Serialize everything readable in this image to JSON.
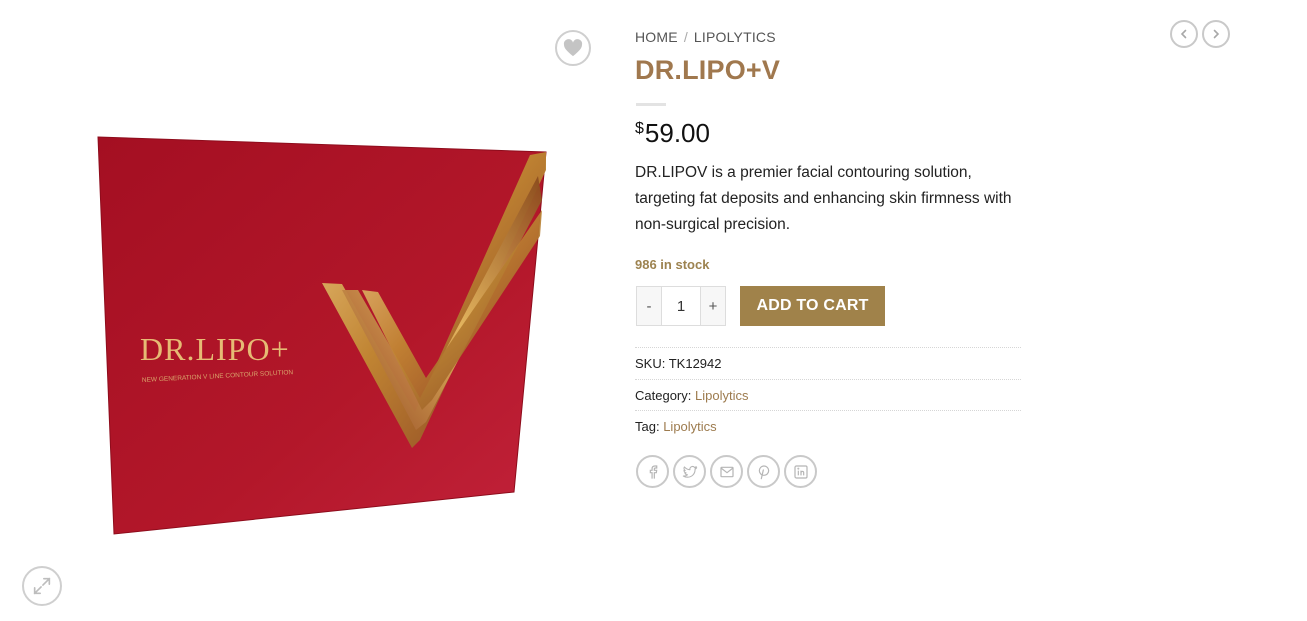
{
  "breadcrumb": {
    "home": "HOME",
    "separator": "/",
    "category": "LIPOLYTICS"
  },
  "product": {
    "title": "DR.LIPO+V",
    "currency": "$",
    "price": "59.00",
    "description": "DR.LIPOV is a premier facial contouring solution, targeting fat deposits and enhancing skin firmness with non-surgical precision.",
    "stock": "986 in stock",
    "quantity": "1",
    "add_to_cart": "ADD TO CART",
    "decrease": "-",
    "increase": "+"
  },
  "image": {
    "brand_text": "DR.LIPO+",
    "tagline": "NEW GENERATION V LINE CONTOUR SOLUTION",
    "box_color": "#b01426",
    "accent_gold": "#c9a04a"
  },
  "meta": {
    "sku_label": "SKU:",
    "sku_value": "TK12942",
    "category_label": "Category:",
    "category_value": "Lipolytics",
    "tag_label": "Tag:",
    "tag_value": "Lipolytics"
  },
  "icons": {
    "wishlist": "heart-icon",
    "zoom": "expand-icon",
    "prev": "chevron-left-icon",
    "next": "chevron-right-icon",
    "share": [
      "facebook-icon",
      "twitter-icon",
      "email-icon",
      "pinterest-icon",
      "linkedin-icon"
    ]
  },
  "colors": {
    "accent": "#a0784e",
    "button": "#a0824a",
    "stock": "#9d8350"
  }
}
